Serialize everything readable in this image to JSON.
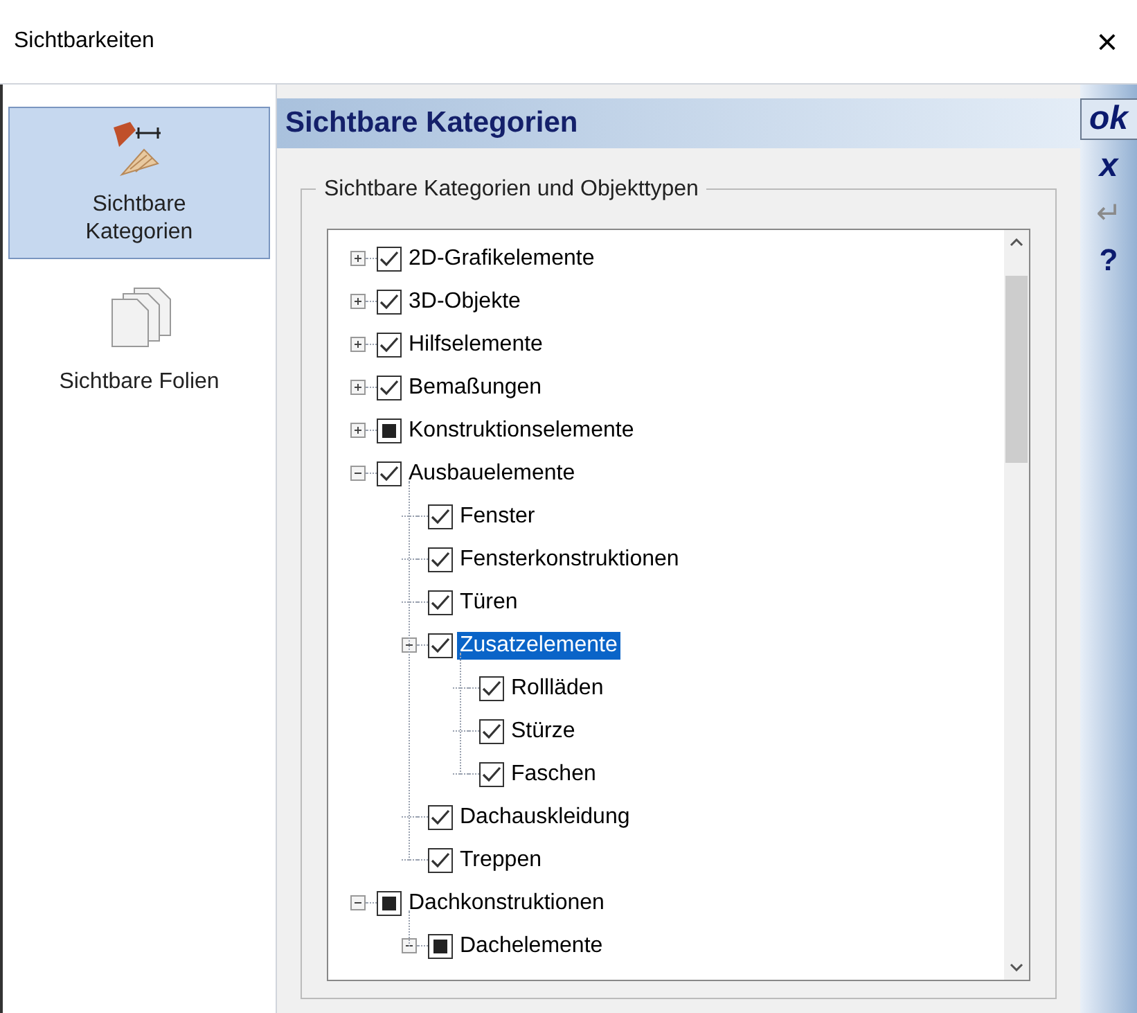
{
  "window": {
    "title": "Sichtbarkeiten",
    "close": "×"
  },
  "sidebar": {
    "items": [
      {
        "label": "Sichtbare Kategorien",
        "selected": true,
        "kind": "categories"
      },
      {
        "label": "Sichtbare Folien",
        "selected": false,
        "kind": "layers"
      }
    ]
  },
  "panel": {
    "title": "Sichtbare Kategorien",
    "group_label": "Sichtbare Kategorien und Objekttypen"
  },
  "tree": [
    {
      "label": "2D-Grafikelemente",
      "checked": true,
      "partial": false,
      "expanded": false,
      "selected": false
    },
    {
      "label": "3D-Objekte",
      "checked": true,
      "partial": false,
      "expanded": false,
      "selected": false
    },
    {
      "label": "Hilfselemente",
      "checked": true,
      "partial": false,
      "expanded": false,
      "selected": false
    },
    {
      "label": "Bemaßungen",
      "checked": true,
      "partial": false,
      "expanded": false,
      "selected": false
    },
    {
      "label": "Konstruktionselemente",
      "checked": true,
      "partial": true,
      "expanded": false,
      "selected": false
    },
    {
      "label": "Ausbauelemente",
      "checked": true,
      "partial": false,
      "expanded": true,
      "selected": false,
      "children": [
        {
          "label": "Fenster",
          "checked": true,
          "partial": false,
          "selected": false
        },
        {
          "label": "Fensterkonstruktionen",
          "checked": true,
          "partial": false,
          "selected": false
        },
        {
          "label": "Türen",
          "checked": true,
          "partial": false,
          "selected": false
        },
        {
          "label": "Zusatzelemente",
          "checked": true,
          "partial": false,
          "expanded": true,
          "selected": true,
          "children": [
            {
              "label": "Rollläden",
              "checked": true,
              "partial": false,
              "selected": false
            },
            {
              "label": "Stürze",
              "checked": true,
              "partial": false,
              "selected": false
            },
            {
              "label": "Faschen",
              "checked": true,
              "partial": false,
              "selected": false
            }
          ]
        },
        {
          "label": "Dachauskleidung",
          "checked": true,
          "partial": false,
          "selected": false
        },
        {
          "label": "Treppen",
          "checked": true,
          "partial": false,
          "selected": false
        }
      ]
    },
    {
      "label": "Dachkonstruktionen",
      "checked": true,
      "partial": true,
      "expanded": true,
      "selected": false,
      "children": [
        {
          "label": "Dachelemente",
          "checked": true,
          "partial": true,
          "expanded": true,
          "selected": false
        }
      ]
    }
  ],
  "actions": [
    {
      "kind": "ok",
      "label": "ok"
    },
    {
      "kind": "cancel",
      "label": "x"
    },
    {
      "kind": "apply",
      "label": "↵"
    },
    {
      "kind": "help",
      "label": "?"
    }
  ]
}
